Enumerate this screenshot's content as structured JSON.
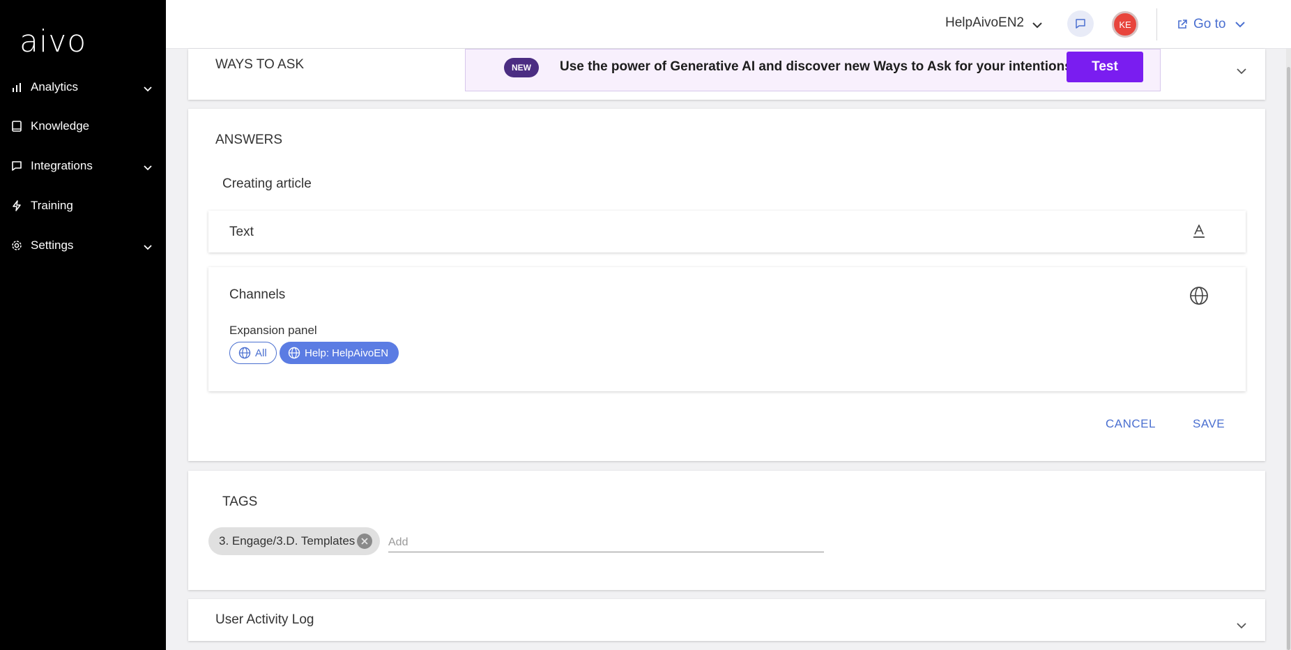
{
  "sidebar": {
    "logo": "aivo",
    "items": [
      {
        "label": "Analytics",
        "icon": "bar-chart-icon",
        "has_submenu": true
      },
      {
        "label": "Knowledge",
        "icon": "book-icon",
        "has_submenu": false
      },
      {
        "label": "Integrations",
        "icon": "chat-bubble-icon",
        "has_submenu": true
      },
      {
        "label": "Training",
        "icon": "lightning-icon",
        "has_submenu": false
      },
      {
        "label": "Settings",
        "icon": "gear-icon",
        "has_submenu": true
      }
    ]
  },
  "header": {
    "workspace": "HelpAivoEN2",
    "avatar_initials": "KE",
    "goto_label": "Go to"
  },
  "ways_to_ask": {
    "title": "WAYS TO ASK",
    "badge": "NEW",
    "banner_text": "Use the power of Generative AI and discover new Ways to Ask for your intentions.",
    "test_label": "Test"
  },
  "answers": {
    "title": "ANSWERS",
    "subtitle": "Creating article",
    "text_panel_label": "Text",
    "channels": {
      "title": "Channels",
      "expansion_label": "Expansion panel",
      "chips": [
        {
          "label": "All",
          "selected": false
        },
        {
          "label": "Help: HelpAivoEN",
          "selected": true
        }
      ]
    },
    "cancel_label": "CANCEL",
    "save_label": "SAVE"
  },
  "tags": {
    "title": "TAGS",
    "items": [
      "3. Engage/3.D. Templates"
    ],
    "input_placeholder": "Add"
  },
  "activity_log": {
    "title": "User Activity Log"
  },
  "colors": {
    "sidebar_bg": "#000000",
    "accent_blue": "#4a6fd0",
    "test_button": "#7a1df0",
    "new_badge": "#4b2d82",
    "avatar": "#e8453c"
  }
}
